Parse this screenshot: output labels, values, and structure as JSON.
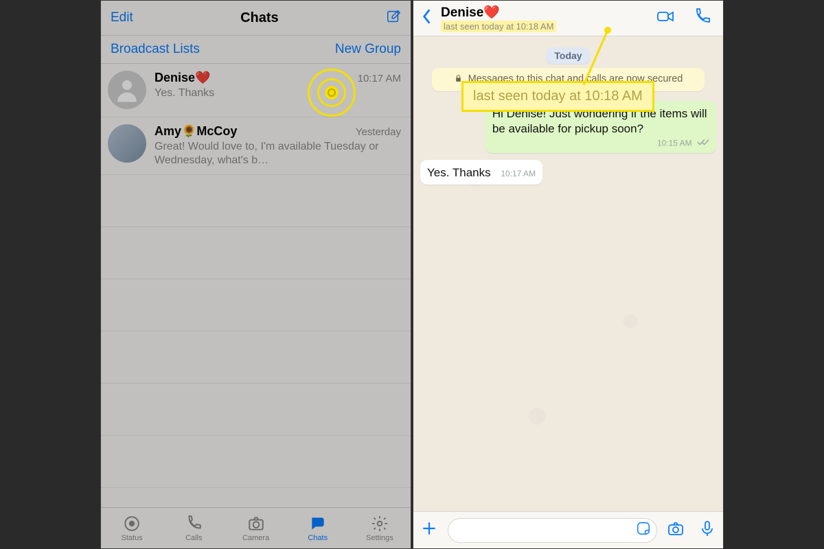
{
  "left": {
    "edit": "Edit",
    "title": "Chats",
    "broadcast": "Broadcast Lists",
    "newgroup": "New Group",
    "rows": [
      {
        "name": "Denise❤️",
        "preview": "Yes. Thanks",
        "when": "10:17 AM"
      },
      {
        "name": "Amy🌻McCoy",
        "preview": "Great!  Would love to, I'm available Tuesday or Wednesday, what's b…",
        "when": "Yesterday"
      }
    ],
    "tabs": {
      "status": "Status",
      "calls": "Calls",
      "camera": "Camera",
      "chats": "Chats",
      "settings": "Settings"
    }
  },
  "right": {
    "name": "Denise❤️",
    "lastseen": "last seen today at 10:18 AM",
    "today": "Today",
    "banner": "Messages to this chat and calls are now secured",
    "messages": {
      "out1": {
        "text": "Hi Denise! Just wondering if the items will be available for pickup soon?",
        "time": "10:15 AM"
      },
      "in1": {
        "text": "Yes. Thanks",
        "time": "10:17 AM"
      }
    },
    "callout": "last seen today at 10:18 AM"
  }
}
